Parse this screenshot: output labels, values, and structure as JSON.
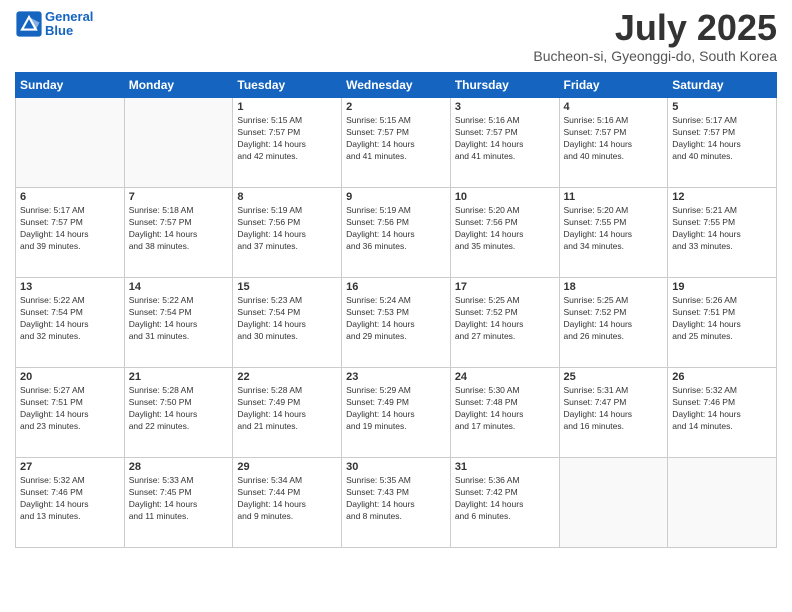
{
  "header": {
    "logo_line1": "General",
    "logo_line2": "Blue",
    "month_title": "July 2025",
    "location": "Bucheon-si, Gyeonggi-do, South Korea"
  },
  "weekdays": [
    "Sunday",
    "Monday",
    "Tuesday",
    "Wednesday",
    "Thursday",
    "Friday",
    "Saturday"
  ],
  "weeks": [
    [
      {
        "day": "",
        "info": ""
      },
      {
        "day": "",
        "info": ""
      },
      {
        "day": "1",
        "info": "Sunrise: 5:15 AM\nSunset: 7:57 PM\nDaylight: 14 hours\nand 42 minutes."
      },
      {
        "day": "2",
        "info": "Sunrise: 5:15 AM\nSunset: 7:57 PM\nDaylight: 14 hours\nand 41 minutes."
      },
      {
        "day": "3",
        "info": "Sunrise: 5:16 AM\nSunset: 7:57 PM\nDaylight: 14 hours\nand 41 minutes."
      },
      {
        "day": "4",
        "info": "Sunrise: 5:16 AM\nSunset: 7:57 PM\nDaylight: 14 hours\nand 40 minutes."
      },
      {
        "day": "5",
        "info": "Sunrise: 5:17 AM\nSunset: 7:57 PM\nDaylight: 14 hours\nand 40 minutes."
      }
    ],
    [
      {
        "day": "6",
        "info": "Sunrise: 5:17 AM\nSunset: 7:57 PM\nDaylight: 14 hours\nand 39 minutes."
      },
      {
        "day": "7",
        "info": "Sunrise: 5:18 AM\nSunset: 7:57 PM\nDaylight: 14 hours\nand 38 minutes."
      },
      {
        "day": "8",
        "info": "Sunrise: 5:19 AM\nSunset: 7:56 PM\nDaylight: 14 hours\nand 37 minutes."
      },
      {
        "day": "9",
        "info": "Sunrise: 5:19 AM\nSunset: 7:56 PM\nDaylight: 14 hours\nand 36 minutes."
      },
      {
        "day": "10",
        "info": "Sunrise: 5:20 AM\nSunset: 7:56 PM\nDaylight: 14 hours\nand 35 minutes."
      },
      {
        "day": "11",
        "info": "Sunrise: 5:20 AM\nSunset: 7:55 PM\nDaylight: 14 hours\nand 34 minutes."
      },
      {
        "day": "12",
        "info": "Sunrise: 5:21 AM\nSunset: 7:55 PM\nDaylight: 14 hours\nand 33 minutes."
      }
    ],
    [
      {
        "day": "13",
        "info": "Sunrise: 5:22 AM\nSunset: 7:54 PM\nDaylight: 14 hours\nand 32 minutes."
      },
      {
        "day": "14",
        "info": "Sunrise: 5:22 AM\nSunset: 7:54 PM\nDaylight: 14 hours\nand 31 minutes."
      },
      {
        "day": "15",
        "info": "Sunrise: 5:23 AM\nSunset: 7:54 PM\nDaylight: 14 hours\nand 30 minutes."
      },
      {
        "day": "16",
        "info": "Sunrise: 5:24 AM\nSunset: 7:53 PM\nDaylight: 14 hours\nand 29 minutes."
      },
      {
        "day": "17",
        "info": "Sunrise: 5:25 AM\nSunset: 7:52 PM\nDaylight: 14 hours\nand 27 minutes."
      },
      {
        "day": "18",
        "info": "Sunrise: 5:25 AM\nSunset: 7:52 PM\nDaylight: 14 hours\nand 26 minutes."
      },
      {
        "day": "19",
        "info": "Sunrise: 5:26 AM\nSunset: 7:51 PM\nDaylight: 14 hours\nand 25 minutes."
      }
    ],
    [
      {
        "day": "20",
        "info": "Sunrise: 5:27 AM\nSunset: 7:51 PM\nDaylight: 14 hours\nand 23 minutes."
      },
      {
        "day": "21",
        "info": "Sunrise: 5:28 AM\nSunset: 7:50 PM\nDaylight: 14 hours\nand 22 minutes."
      },
      {
        "day": "22",
        "info": "Sunrise: 5:28 AM\nSunset: 7:49 PM\nDaylight: 14 hours\nand 21 minutes."
      },
      {
        "day": "23",
        "info": "Sunrise: 5:29 AM\nSunset: 7:49 PM\nDaylight: 14 hours\nand 19 minutes."
      },
      {
        "day": "24",
        "info": "Sunrise: 5:30 AM\nSunset: 7:48 PM\nDaylight: 14 hours\nand 17 minutes."
      },
      {
        "day": "25",
        "info": "Sunrise: 5:31 AM\nSunset: 7:47 PM\nDaylight: 14 hours\nand 16 minutes."
      },
      {
        "day": "26",
        "info": "Sunrise: 5:32 AM\nSunset: 7:46 PM\nDaylight: 14 hours\nand 14 minutes."
      }
    ],
    [
      {
        "day": "27",
        "info": "Sunrise: 5:32 AM\nSunset: 7:46 PM\nDaylight: 14 hours\nand 13 minutes."
      },
      {
        "day": "28",
        "info": "Sunrise: 5:33 AM\nSunset: 7:45 PM\nDaylight: 14 hours\nand 11 minutes."
      },
      {
        "day": "29",
        "info": "Sunrise: 5:34 AM\nSunset: 7:44 PM\nDaylight: 14 hours\nand 9 minutes."
      },
      {
        "day": "30",
        "info": "Sunrise: 5:35 AM\nSunset: 7:43 PM\nDaylight: 14 hours\nand 8 minutes."
      },
      {
        "day": "31",
        "info": "Sunrise: 5:36 AM\nSunset: 7:42 PM\nDaylight: 14 hours\nand 6 minutes."
      },
      {
        "day": "",
        "info": ""
      },
      {
        "day": "",
        "info": ""
      }
    ]
  ]
}
